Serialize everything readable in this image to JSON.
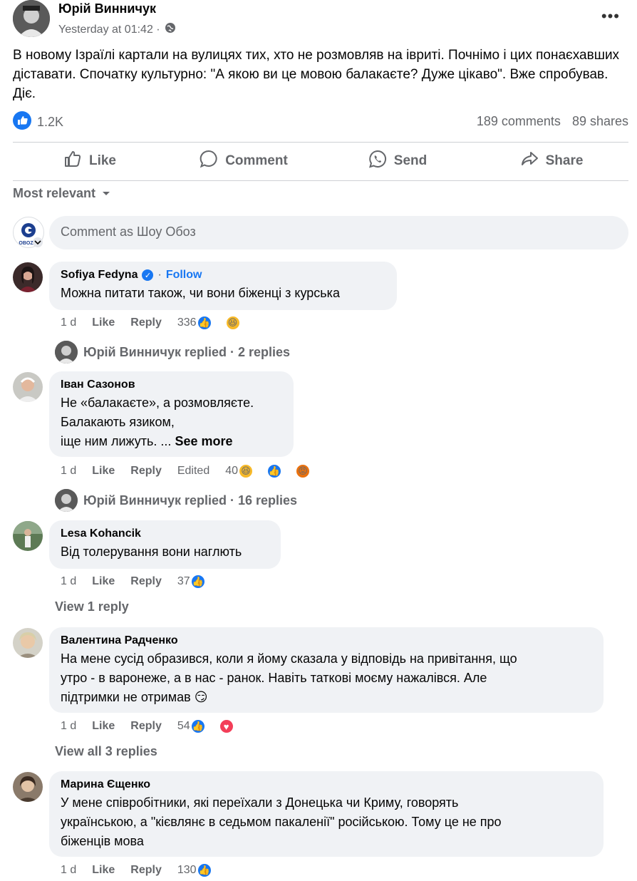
{
  "post": {
    "author": "Юрій Винничук",
    "time": "Yesterday at 01:42 ·",
    "privacy_icon": "globe-icon",
    "text": "В новому Ізраїлі картали на вулицях тих, хто не розмовляв на івриті. Почнімо і цих понаєхавших діставати. Спочатку культурно: \"А якою ви це мовою балакаєте? Дуже цікаво\". Вже спробував. Діє.",
    "likes": "1.2K",
    "comments": "189 comments",
    "shares": "89 shares"
  },
  "actions": {
    "like": "Like",
    "comment": "Comment",
    "send": "Send",
    "share": "Share"
  },
  "sort_label": "Most relevant",
  "composer": {
    "placeholder": "Comment as Шоу Обоз",
    "avatar_text": "OBOZ.U"
  },
  "comments": [
    {
      "name": "Sofiya Fedyna",
      "follow": "Follow",
      "text": "Можна питати також, чи вони біженці з курська",
      "age": "1 d",
      "like": "Like",
      "reply": "Reply",
      "count": "336",
      "replies": "Юрій Винничук replied · 2 replies"
    },
    {
      "name": "Іван Сазонов",
      "text_lines": [
        "Не «балакаєте», а розмовляєте.",
        "Балакають язиком,",
        "іще ним лижуть. ..."
      ],
      "see_more": "See more",
      "age": "1 d",
      "like": "Like",
      "reply": "Reply",
      "edited": "Edited",
      "count": "40",
      "replies": "Юрій Винничук replied · 16 replies"
    },
    {
      "name": "Lesa Kohancik",
      "text": "Від толерування вони наглють",
      "age": "1 d",
      "like": "Like",
      "reply": "Reply",
      "count": "37",
      "replies": "View 1 reply"
    },
    {
      "name": "Валентина Радченко",
      "text_lines": [
        "На мене сусід образився, коли я йому сказала у відповідь на привітання, що",
        "утро - в варонеже, а в нас - ранок. Навіть таткові моєму нажалівся. Але",
        "підтримки не отримав 😏"
      ],
      "age": "1 d",
      "like": "Like",
      "reply": "Reply",
      "count": "54",
      "replies": "View all 3 replies"
    },
    {
      "name": "Марина Єщенко",
      "text_lines": [
        "У мене співробітники, які переїхали з Донецька чи Криму, говорять",
        "українською, а \"кієвлянє в седьмом пакаленії\" російською. Тому це не про",
        "біженців мова"
      ],
      "age": "1 d",
      "like": "Like",
      "reply": "Reply",
      "count": "130"
    }
  ]
}
